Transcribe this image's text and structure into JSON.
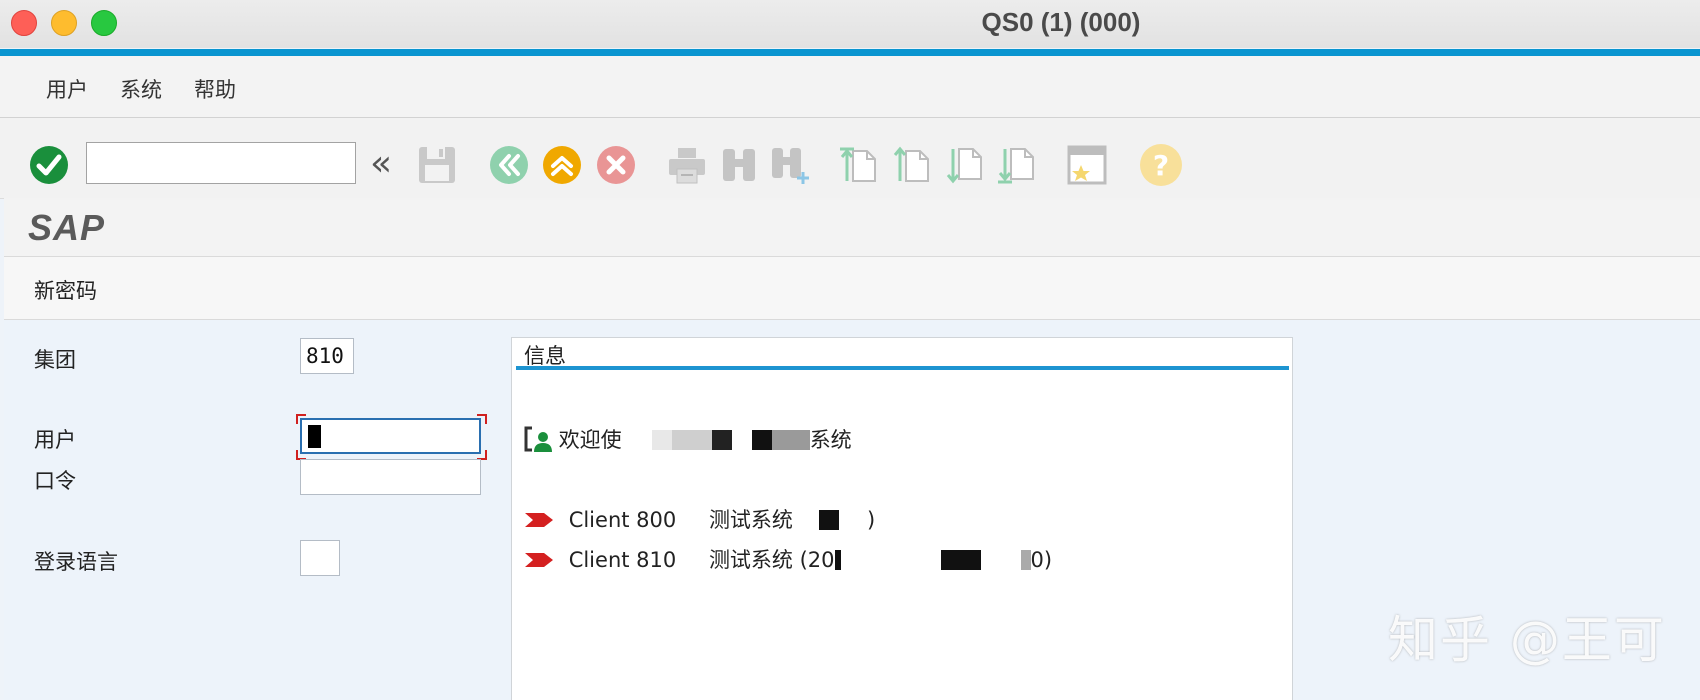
{
  "window": {
    "title": "QS0 (1) (000)"
  },
  "menu": {
    "items": [
      "用户",
      "系统",
      "帮助"
    ]
  },
  "toolbar": {
    "command_field_value": "",
    "expand_glyph": "«",
    "help_glyph": "?"
  },
  "header": {
    "logo": "SAP"
  },
  "screen": {
    "title": "新密码"
  },
  "login": {
    "client_label": "集团",
    "client_value": "810",
    "user_label": "用户",
    "password_label": "口令",
    "language_label": "登录语言"
  },
  "info": {
    "title": "信息",
    "welcome_prefix": "欢迎使",
    "welcome_suffix": "系统",
    "clients": [
      {
        "id": "Client 800",
        "desc_prefix": "测试系统",
        "desc_suffix": ")"
      },
      {
        "id": "Client 810",
        "desc_prefix": "测试系统 (20",
        "desc_suffix": "0)"
      }
    ]
  },
  "watermark": "知乎 @王可",
  "colors": {
    "accent": "#0a95d0",
    "info_underline": "#1d94d1",
    "ok_green": "#1a8f3c",
    "back_green": "#8fd1ad",
    "exit_orange": "#f0a800",
    "cancel_red": "#e99595"
  },
  "icons": [
    "check-icon",
    "expand-icon",
    "save-icon",
    "back-icon",
    "exit-icon",
    "cancel-icon",
    "print-icon",
    "find-icon",
    "find-next-icon",
    "first-page-icon",
    "previous-page-icon",
    "next-page-icon",
    "last-page-icon",
    "new-window-icon",
    "help-icon",
    "user-icon",
    "arrow-icon"
  ]
}
